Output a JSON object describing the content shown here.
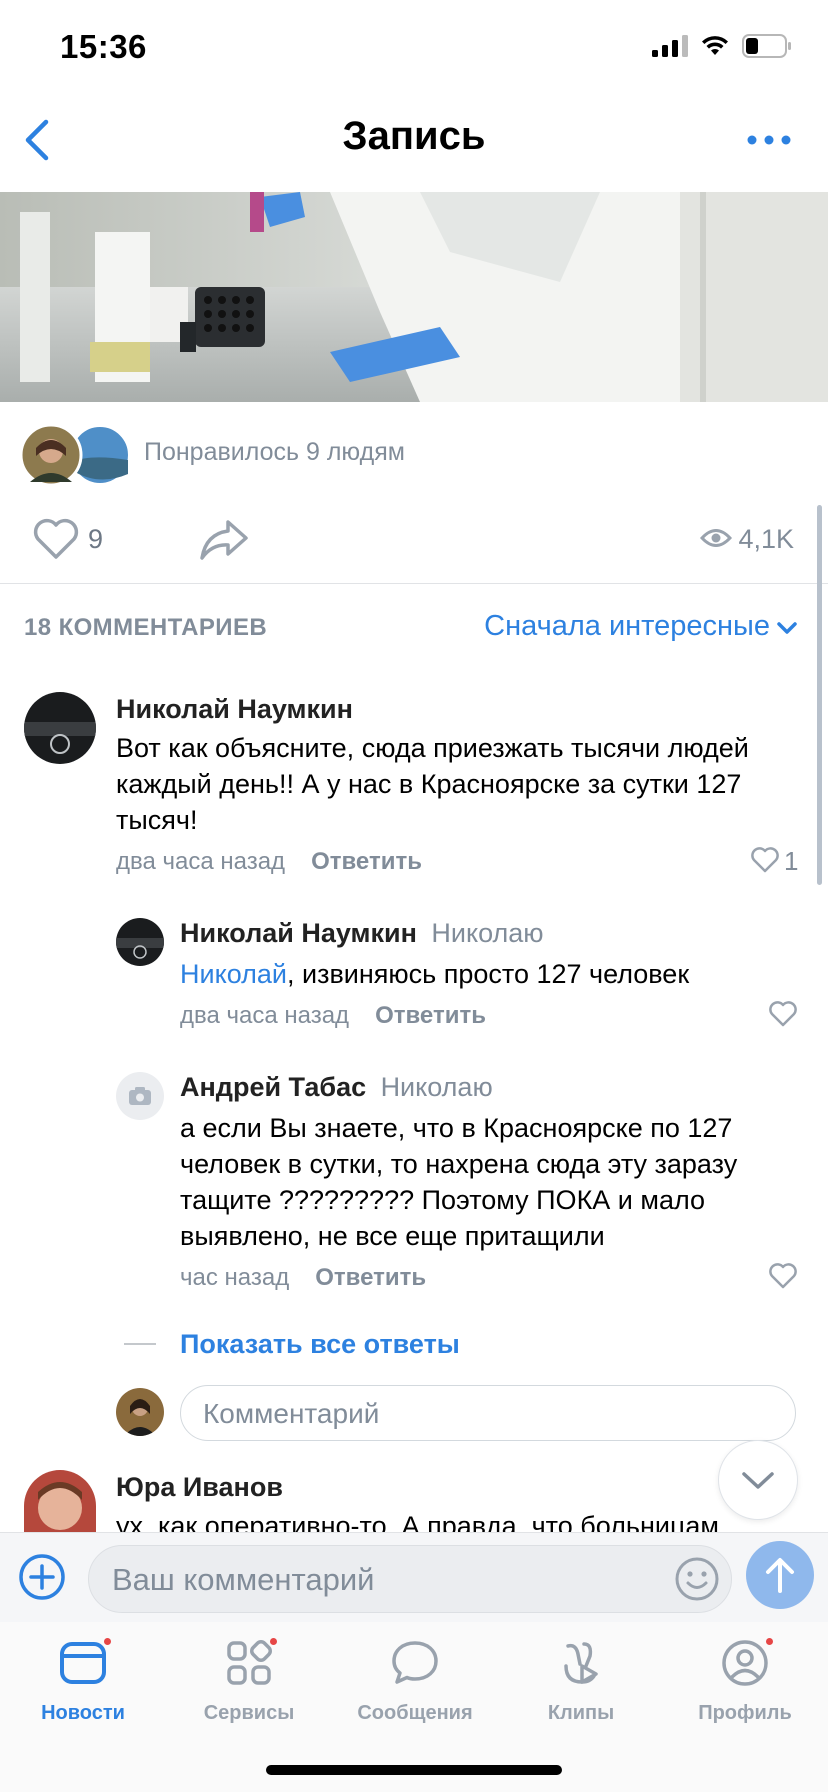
{
  "status_bar": {
    "time": "15:36"
  },
  "header": {
    "title": "Запись"
  },
  "post": {
    "liked_by_text": "Понравилось 9 людям",
    "like_count": "9",
    "views": "4,1K"
  },
  "comments_section": {
    "count_label": "18 КОММЕНТАРИЕВ",
    "sort_label": "Сначала интересные"
  },
  "comments": [
    {
      "author": "Николай Наумкин",
      "text": "Вот как объясните, сюда приезжать тысячи людей каждый день!! А у нас в Красноярске за сутки 127 тысяч!",
      "time": "два часа назад",
      "reply_label": "Ответить",
      "likes": "1"
    }
  ],
  "replies": [
    {
      "author": "Николай Наумкин",
      "to": "Николаю",
      "mention": "Николай",
      "text": ", извиняюсь просто 127 человек",
      "time": "два часа назад",
      "reply_label": "Ответить"
    },
    {
      "author": "Андрей Табас",
      "to": "Николаю",
      "text": "а если Вы знаете, что в Красноярске по 127 человек в сутки, то нахрена сюда эту заразу тащите ????????? Поэтому ПОКА и мало выявлено, не все еще притащили",
      "time": "час назад",
      "reply_label": "Ответить"
    }
  ],
  "show_all_replies": "Показать все ответы",
  "reply_input_placeholder": "Комментарий",
  "next_comment": {
    "author": "Юра Иванов",
    "text": "ух, как оперативно-то. А правда, что больницам"
  },
  "composer": {
    "placeholder": "Ваш комментарий"
  },
  "tabs": [
    {
      "label": "Новости",
      "active": true
    },
    {
      "label": "Сервисы"
    },
    {
      "label": "Сообщения"
    },
    {
      "label": "Клипы"
    },
    {
      "label": "Профиль"
    }
  ],
  "colors": {
    "accent": "#2d81e0",
    "secondary_text": "#818c99",
    "badge": "#e64646"
  }
}
